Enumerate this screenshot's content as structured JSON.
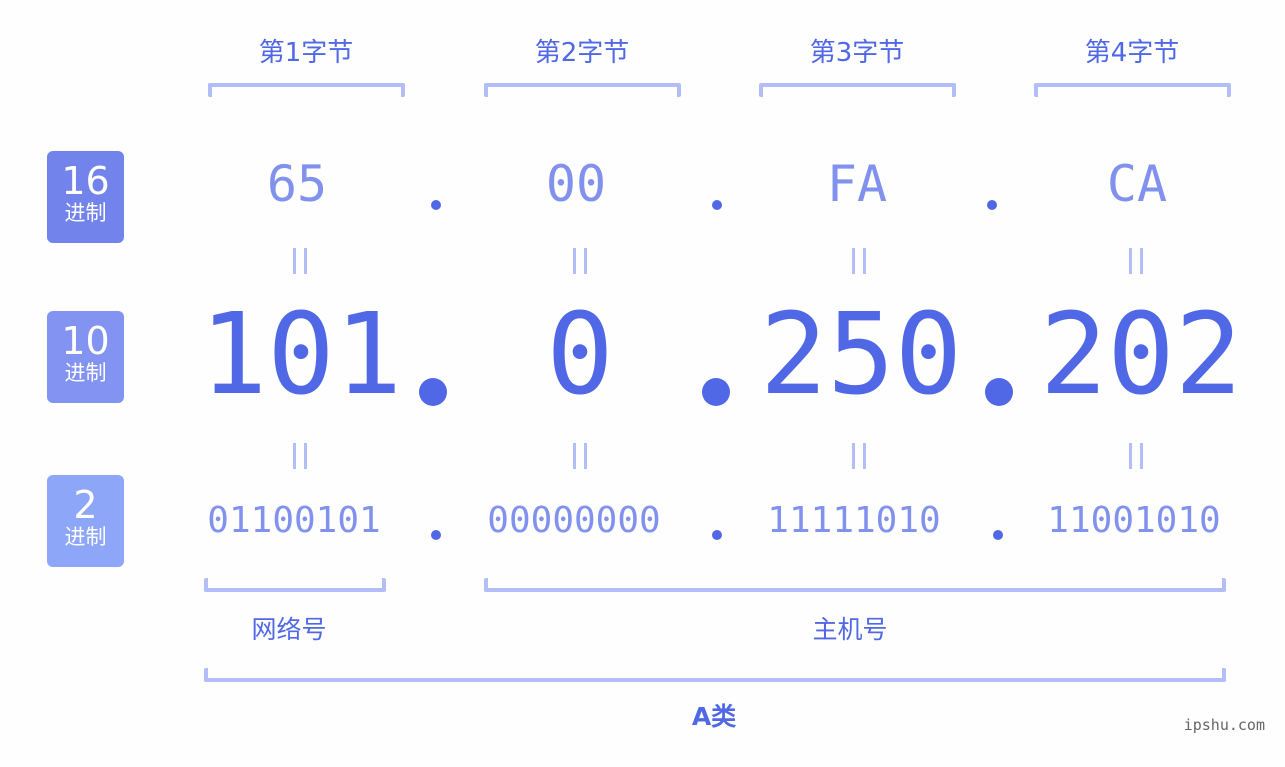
{
  "byte_labels": [
    "第1字节",
    "第2字节",
    "第3字节",
    "第4字节"
  ],
  "rows": {
    "hex": {
      "badge_num": "16",
      "badge_unit": "进制",
      "badge_color": "#7383ec",
      "values": [
        "65",
        "00",
        "FA",
        "CA"
      ]
    },
    "dec": {
      "badge_num": "10",
      "badge_unit": "进制",
      "badge_color": "#8293f2",
      "values": [
        "101",
        "0",
        "250",
        "202"
      ]
    },
    "bin": {
      "badge_num": "2",
      "badge_unit": "进制",
      "badge_color": "#8ea6f8",
      "values": [
        "01100101",
        "00000000",
        "11111010",
        "11001010"
      ]
    }
  },
  "separator": ".",
  "parts": {
    "network": "网络号",
    "host": "主机号",
    "class": "A类"
  },
  "watermark": "ipshu.com",
  "colors": {
    "primary": "#5168e6",
    "secondary": "#8191ee",
    "bracket": "#b3bdf8"
  }
}
